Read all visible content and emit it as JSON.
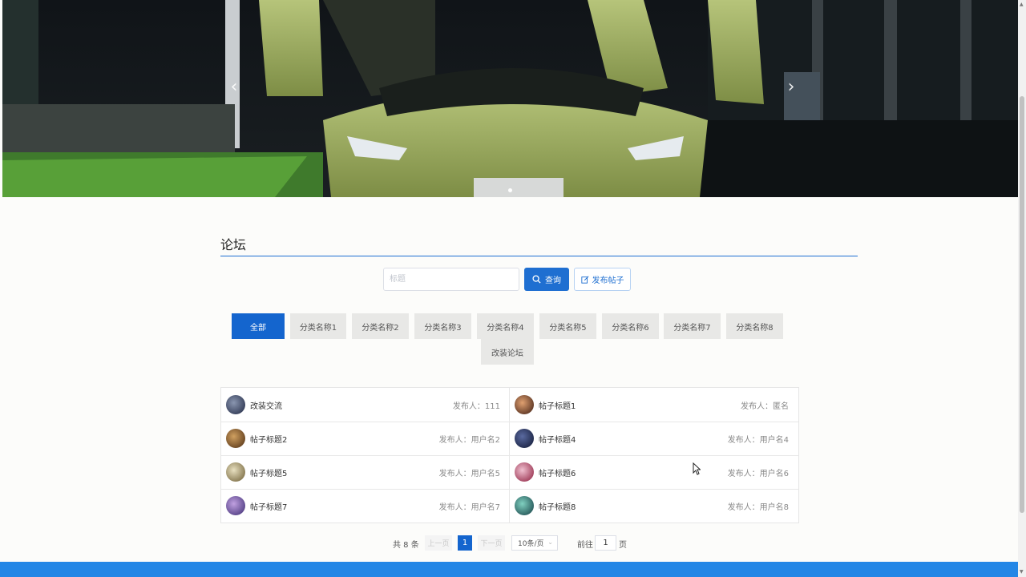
{
  "banner": {
    "prev_arrow": "‹",
    "next_arrow": "›"
  },
  "forum": {
    "title": "论坛"
  },
  "search": {
    "placeholder": "标题",
    "query_label": "查询",
    "post_label": "发布帖子"
  },
  "categories": [
    {
      "label": "全部",
      "active": true
    },
    {
      "label": "分类名称1"
    },
    {
      "label": "分类名称2"
    },
    {
      "label": "分类名称3"
    },
    {
      "label": "分类名称4"
    },
    {
      "label": "分类名称5"
    },
    {
      "label": "分类名称6"
    },
    {
      "label": "分类名称7"
    },
    {
      "label": "分类名称8"
    },
    {
      "label": "改装论坛"
    }
  ],
  "posts": [
    {
      "title": "改装交流",
      "author": "发布人：111"
    },
    {
      "title": "帖子标题1",
      "author": "发布人：匿名"
    },
    {
      "title": "帖子标题2",
      "author": "发布人：用户名2"
    },
    {
      "title": "帖子标题4",
      "author": "发布人：用户名4"
    },
    {
      "title": "帖子标题5",
      "author": "发布人：用户名5"
    },
    {
      "title": "帖子标题6",
      "author": "发布人：用户名6"
    },
    {
      "title": "帖子标题7",
      "author": "发布人：用户名7"
    },
    {
      "title": "帖子标题8",
      "author": "发布人：用户名8"
    }
  ],
  "pagination": {
    "total": "共 8 条",
    "prev": "上一页",
    "current": "1",
    "next": "下一页",
    "page_size": "10条/页",
    "goto": "前往",
    "goto_value": "1",
    "page_suffix": "页"
  },
  "colors": {
    "primary": "#1465ce",
    "footer": "#2386e6"
  }
}
